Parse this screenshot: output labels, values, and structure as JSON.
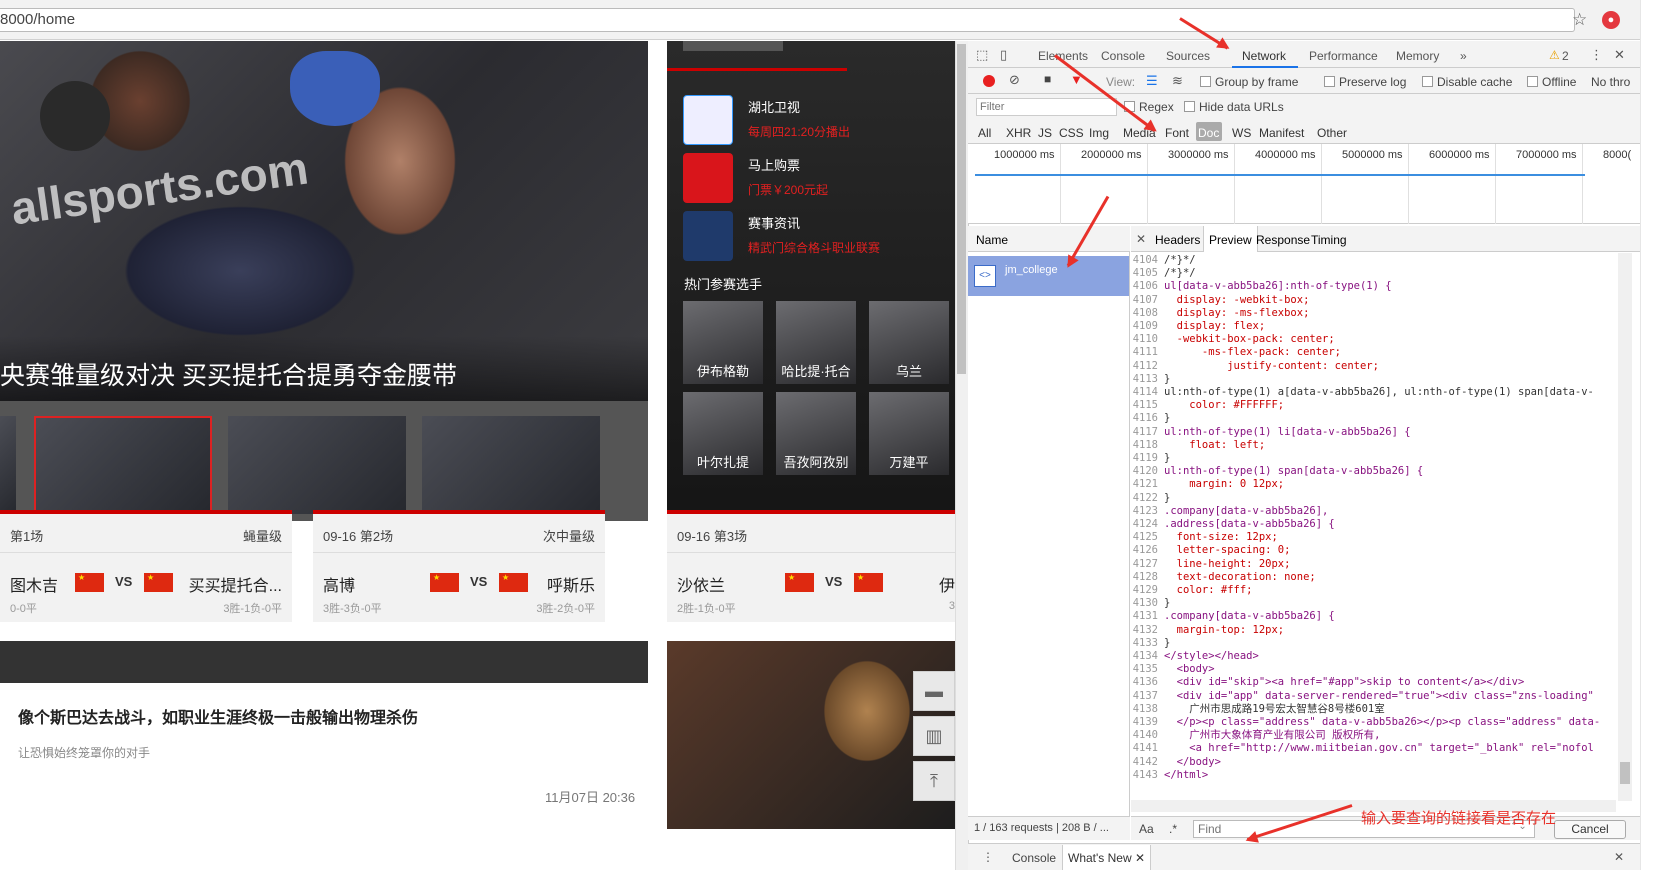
{
  "browser": {
    "url": "8000/home"
  },
  "page": {
    "hero_title": "央赛雏量级对决 买买提托合提勇夺金腰带",
    "hero_watermark": "allsports.com",
    "side": {
      "items": [
        {
          "name": "湖北卫视",
          "sub": "每周四21:20分播出",
          "icon": "tv-logo-icon"
        },
        {
          "name": "马上购票",
          "sub": "门票￥200元起",
          "icon": "ticket-icon"
        },
        {
          "name": "赛事资讯",
          "sub": "精武门综合格斗职业联赛",
          "icon": "trophy-icon"
        }
      ],
      "hot_label": "热门参赛选手",
      "players": [
        "伊布格勒",
        "哈比提·托合",
        "乌兰",
        "叶尔扎提",
        "吾孜阿孜别",
        "万建平"
      ]
    },
    "matches": [
      {
        "date": "第1场",
        "weight": "蝇量级",
        "p1": "图木吉",
        "r1": "0-0平",
        "p2": "买买提托合...",
        "r2": "3胜-1负-0平",
        "vs": "VS"
      },
      {
        "date": "09-16 第2场",
        "weight": "次中量级",
        "p1": "高博",
        "r1": "3胜-3负-0平",
        "p2": "呼斯乐",
        "r2": "3胜-2负-0平",
        "vs": "VS"
      },
      {
        "date": "09-16 第3场",
        "weight": "",
        "p1": "沙依兰",
        "r1": "2胜-1负-0平",
        "p2": "伊",
        "r2": "3",
        "vs": "VS"
      }
    ],
    "news": {
      "title": "像个斯巴达去战斗，如职业生涯终极一击般输出物理杀伤",
      "sub": "让恐惧始终笼罩你的对手",
      "time": "11月07日 20:36"
    }
  },
  "devtools": {
    "tabs": [
      "Elements",
      "Console",
      "Sources",
      "Network",
      "Performance",
      "Memory",
      "»"
    ],
    "warnings": "2",
    "toolbar": {
      "view": "View:",
      "group_by_frame": "Group by frame",
      "preserve_log": "Preserve log",
      "disable_cache": "Disable cache",
      "offline": "Offline",
      "throttle": "No thro"
    },
    "filter": {
      "placeholder": "Filter",
      "regex": "Regex",
      "hide_data": "Hide data URLs"
    },
    "types": [
      "All",
      "XHR",
      "JS",
      "CSS",
      "Img",
      "Media",
      "Font",
      "Doc",
      "WS",
      "Manifest",
      "Other"
    ],
    "ticks": [
      "1000000 ms",
      "2000000 ms",
      "3000000 ms",
      "4000000 ms",
      "5000000 ms",
      "6000000 ms",
      "7000000 ms",
      "8000("
    ],
    "name_header": "Name",
    "request": "jm_college",
    "detail_tabs": [
      "Headers",
      "Preview",
      "Response",
      "Timing"
    ],
    "status": "1 / 163 requests | 208 B / ...",
    "find": {
      "case": "Aa",
      "regex": ".*",
      "placeholder": "Find",
      "cancel": "Cancel"
    },
    "drawer": [
      "Console",
      "What's New"
    ],
    "annotation": "输入要查询的链接看是否存在"
  },
  "code_lines": [
    [
      "4104",
      "/*}*/"
    ],
    [
      "4105",
      "/*}*/"
    ],
    [
      "4106",
      "ul[data-v-abb5ba26]:nth-of-type(1) {"
    ],
    [
      "4107",
      "  display: -webkit-box;"
    ],
    [
      "4108",
      "  display: -ms-flexbox;"
    ],
    [
      "4109",
      "  display: flex;"
    ],
    [
      "4110",
      "  -webkit-box-pack: center;"
    ],
    [
      "4111",
      "      -ms-flex-pack: center;"
    ],
    [
      "4112",
      "          justify-content: center;"
    ],
    [
      "4113",
      "}"
    ],
    [
      "4114",
      "ul:nth-of-type(1) a[data-v-abb5ba26], ul:nth-of-type(1) span[data-v-"
    ],
    [
      "4115",
      "    color: #FFFFFF;"
    ],
    [
      "4116",
      "}"
    ],
    [
      "4117",
      "ul:nth-of-type(1) li[data-v-abb5ba26] {"
    ],
    [
      "4118",
      "    float: left;"
    ],
    [
      "4119",
      "}"
    ],
    [
      "4120",
      "ul:nth-of-type(1) span[data-v-abb5ba26] {"
    ],
    [
      "4121",
      "    margin: 0 12px;"
    ],
    [
      "4122",
      "}"
    ],
    [
      "4123",
      ".company[data-v-abb5ba26],"
    ],
    [
      "4124",
      ".address[data-v-abb5ba26] {"
    ],
    [
      "4125",
      "  font-size: 12px;"
    ],
    [
      "4126",
      "  letter-spacing: 0;"
    ],
    [
      "4127",
      "  line-height: 20px;"
    ],
    [
      "4128",
      "  text-decoration: none;"
    ],
    [
      "4129",
      "  color: #fff;"
    ],
    [
      "4130",
      "}"
    ],
    [
      "4131",
      ".company[data-v-abb5ba26] {"
    ],
    [
      "4132",
      "  margin-top: 12px;"
    ],
    [
      "4133",
      "}"
    ],
    [
      "4134",
      "</style></head>"
    ],
    [
      "4135",
      "  <body>"
    ],
    [
      "4136",
      "  <div id=\"skip\"><a href=\"#app\">skip to content</a></div>"
    ],
    [
      "4137",
      "  <div id=\"app\" data-server-rendered=\"true\"><div class=\"zns-loading\""
    ],
    [
      "4138",
      "    广州市思成路19号宏太智慧谷8号楼601室"
    ],
    [
      "4139",
      "  </p><p class=\"address\" data-v-abb5ba26></p><p class=\"address\" data-"
    ],
    [
      "4140",
      "    广州市大象体育产业有限公司 版权所有,"
    ],
    [
      "4141",
      "    <a href=\"http://www.miitbeian.gov.cn\" target=\"_blank\" rel=\"nofol"
    ],
    [
      "4142",
      "  </body>"
    ],
    [
      "4143",
      "</html>"
    ]
  ]
}
